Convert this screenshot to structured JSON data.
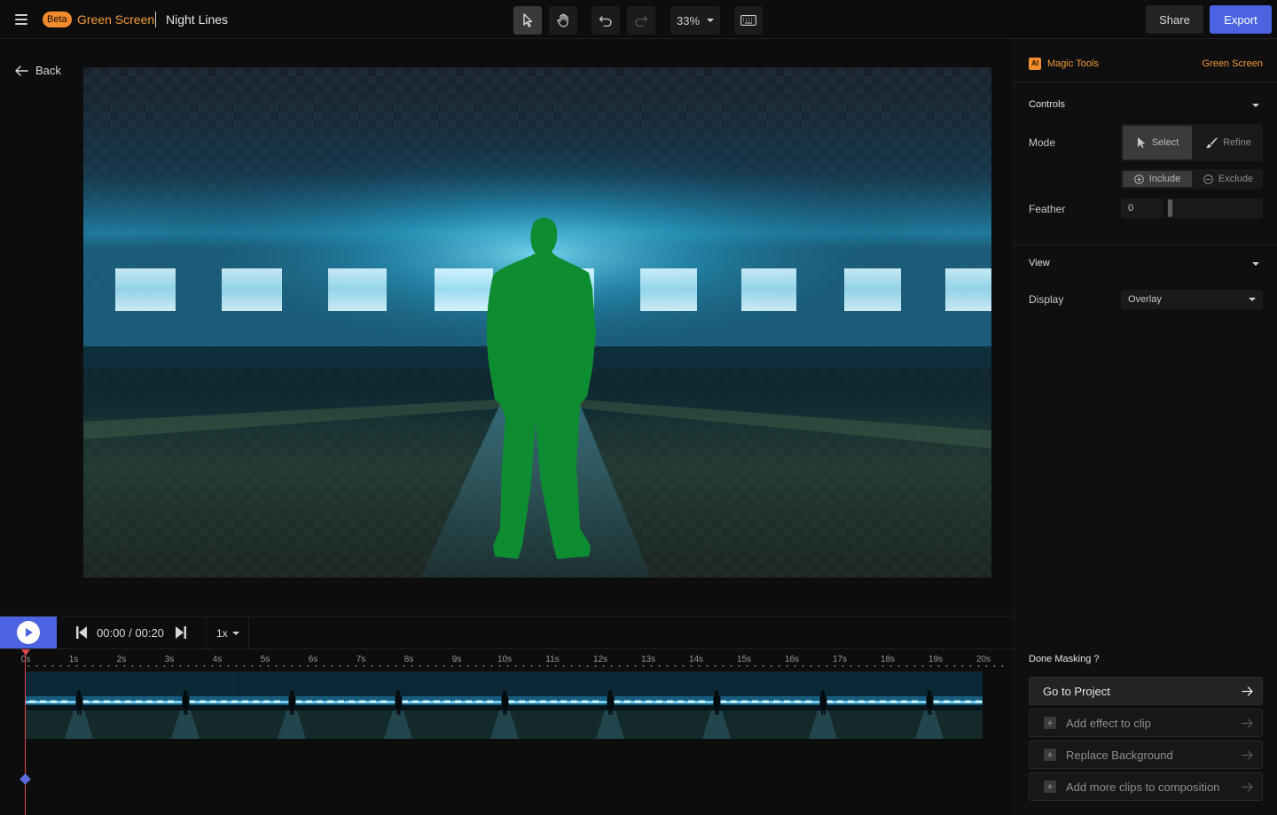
{
  "header": {
    "badge": "Beta",
    "app_title": "Green Screen",
    "project_title": "Night Lines",
    "zoom": "33%",
    "share_label": "Share",
    "export_label": "Export"
  },
  "main": {
    "back_label": "Back"
  },
  "timeline": {
    "time_display": "00:00 / 00:20",
    "speed": "1x",
    "ticks": [
      "0s",
      "1s",
      "2s",
      "3s",
      "4s",
      "5s",
      "6s",
      "7s",
      "8s",
      "9s",
      "10s",
      "11s",
      "12s",
      "13s",
      "14s",
      "15s",
      "16s",
      "17s",
      "18s",
      "19s",
      "20s"
    ]
  },
  "panel": {
    "ai_badge": "AI",
    "magic_tools_label": "Magic Tools",
    "current_tool": "Green Screen",
    "controls": {
      "title": "Controls",
      "mode_label": "Mode",
      "mode_options": [
        "Select",
        "Refine"
      ],
      "mode_selected": "Select",
      "include_options": [
        "Include",
        "Exclude"
      ],
      "include_selected": "Include",
      "feather_label": "Feather",
      "feather_value": "0"
    },
    "view": {
      "title": "View",
      "display_label": "Display",
      "display_value": "Overlay"
    },
    "done": {
      "title": "Done Masking ?",
      "go_to_project": "Go to Project",
      "actions": [
        "Add effect to clip",
        "Replace Background",
        "Add more clips to composition"
      ]
    }
  },
  "colors": {
    "accent": "#4b63e0",
    "brand_orange": "#f39a3c",
    "mask_green": "#0e8c32",
    "playhead": "#e04848"
  }
}
